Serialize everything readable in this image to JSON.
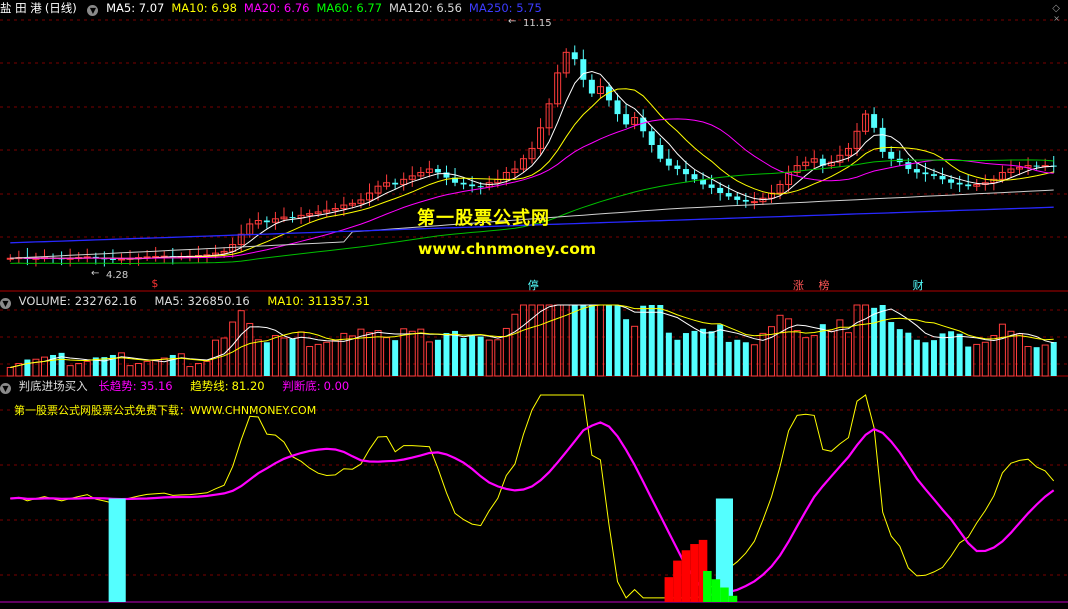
{
  "main": {
    "stock": "盐 田 港",
    "period": "(日线)",
    "ma": [
      {
        "label": "MA5:",
        "value": "7.07",
        "color": "#ffffff"
      },
      {
        "label": "MA10:",
        "value": "6.98",
        "color": "#ffff00"
      },
      {
        "label": "MA20:",
        "value": "6.76",
        "color": "#ff00ff"
      },
      {
        "label": "MA60:",
        "value": "6.77",
        "color": "#00ff00"
      },
      {
        "label": "MA120:",
        "value": "6.56",
        "color": "#d8d8d8"
      },
      {
        "label": "MA250:",
        "value": "5.75",
        "color": "#3c3cff"
      }
    ],
    "high_label": "11.15",
    "low_label": "4.28",
    "markers": [
      {
        "text": "$",
        "x_index": 17,
        "color": "#ff3333"
      },
      {
        "text": "停",
        "x_index": 61,
        "color": "#54ffff"
      },
      {
        "text": "涨",
        "x_index": 92,
        "color": "#ff5555"
      },
      {
        "text": "榜",
        "x_index": 95,
        "color": "#ff5555"
      },
      {
        "text": "财",
        "x_index": 106,
        "color": "#54ffff"
      }
    ]
  },
  "watermark": {
    "line1": "第一股票公式网",
    "line2": "www.chnmoney.com"
  },
  "volume": {
    "label": "VOLUME:",
    "value": "232762.16",
    "ma5_label": "MA5:",
    "ma5_value": "326850.16",
    "ma10_label": "MA10:",
    "ma10_value": "311357.31"
  },
  "indicator": {
    "name": "判底进场买入",
    "long_label": "长趋势:",
    "long_value": "35.16",
    "trend_label": "趋势线:",
    "trend_value": "81.20",
    "judge_label": "判断底:",
    "judge_value": "0.00",
    "subtitle": "第一股票公式网股票公式免费下载：WWW.CHNMONEY.COM"
  },
  "colors": {
    "up": "#ff3c3c",
    "down": "#54ffff",
    "grid": "#7a0000",
    "separator": "#b00000"
  },
  "chart_data": {
    "type": "candlestick",
    "bars": 123,
    "note_close": [
      4.4,
      4.42,
      4.38,
      4.4,
      4.42,
      4.4,
      4.38,
      4.4,
      4.42,
      4.44,
      4.4,
      4.38,
      4.36,
      4.38,
      4.4,
      4.42,
      4.44,
      4.45,
      4.46,
      4.44,
      4.45,
      4.46,
      4.48,
      4.5,
      4.55,
      4.6,
      4.8,
      5.1,
      5.4,
      5.5,
      5.45,
      5.55,
      5.6,
      5.58,
      5.65,
      5.7,
      5.75,
      5.8,
      5.85,
      5.95,
      6.0,
      6.1,
      6.3,
      6.5,
      6.6,
      6.55,
      6.7,
      6.8,
      6.9,
      7.0,
      6.9,
      6.75,
      6.6,
      6.55,
      6.5,
      6.48,
      6.6,
      6.7,
      6.9,
      7.0,
      7.3,
      7.6,
      8.2,
      8.9,
      9.8,
      10.4,
      10.2,
      9.6,
      9.2,
      9.4,
      9.0,
      8.6,
      8.3,
      8.5,
      8.1,
      7.7,
      7.3,
      7.1,
      7.0,
      6.85,
      6.7,
      6.55,
      6.45,
      6.3,
      6.2,
      6.1,
      6.05,
      6.05,
      6.15,
      6.3,
      6.55,
      6.9,
      7.1,
      7.2,
      7.3,
      7.1,
      7.2,
      7.4,
      7.6,
      8.1,
      8.6,
      8.2,
      7.5,
      7.3,
      7.2,
      7.0,
      6.9,
      6.85,
      6.8,
      6.7,
      6.6,
      6.55,
      6.5,
      6.55,
      6.6,
      6.7,
      6.9,
      7.0,
      7.05,
      7.1,
      7.08,
      7.1,
      7.07
    ],
    "volume_ma5": "326850.16",
    "volume_ma10": "311357.31",
    "indicator_values": {
      "long": 35.16,
      "trend": 81.2,
      "judge": 0.0
    }
  }
}
